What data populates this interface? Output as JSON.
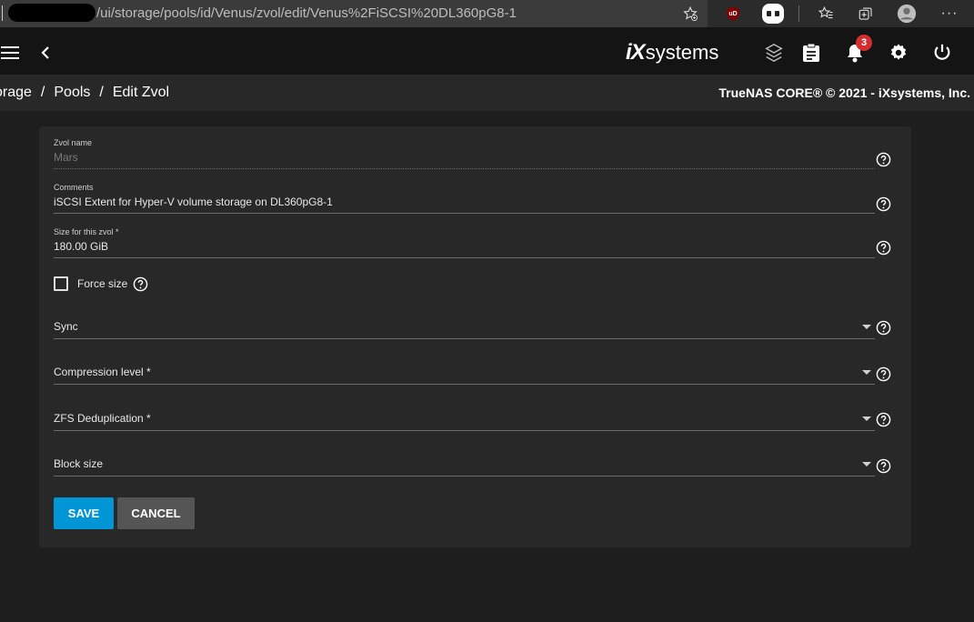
{
  "browser": {
    "url": "/ui/storage/pools/id/Venus/zvol/edit/Venus%2FiSCSI%20DL360pG8-1",
    "extension_badge": "uD"
  },
  "header": {
    "logo_ix": "iX",
    "logo_systems": "systems",
    "notification_count": "3"
  },
  "breadcrumb": {
    "items": [
      "orage",
      "Pools",
      "Edit Zvol"
    ],
    "separator": "/"
  },
  "copyright": "TrueNAS CORE® © 2021 - iXsystems, Inc.",
  "form": {
    "zvol_name": {
      "label": "Zvol name",
      "value": "Mars"
    },
    "comments": {
      "label": "Comments",
      "value": "iSCSI Extent for Hyper-V volume storage on DL360pG8-1"
    },
    "size": {
      "label": "Size for this zvol *",
      "value": "180.00 GiB"
    },
    "force_size": {
      "label": "Force size",
      "checked": false
    },
    "sync": {
      "label": "Sync"
    },
    "compression": {
      "label": "Compression level *"
    },
    "dedup": {
      "label": "ZFS Deduplication *"
    },
    "block_size": {
      "label": "Block size"
    },
    "save_label": "SAVE",
    "cancel_label": "CANCEL"
  },
  "colors": {
    "accent": "#0095d5",
    "badge": "#d32f2f",
    "card": "#282828",
    "header": "#141414"
  }
}
